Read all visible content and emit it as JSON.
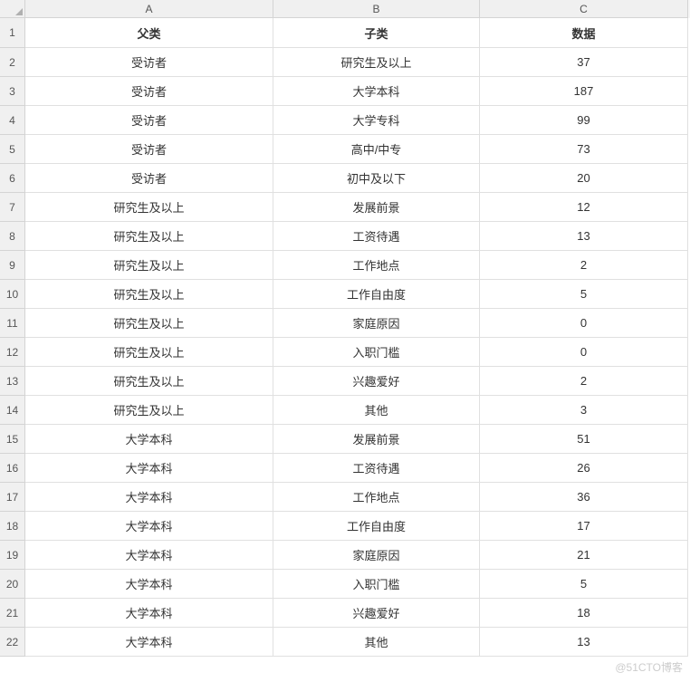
{
  "columns": [
    "A",
    "B",
    "C"
  ],
  "headers": [
    "父类",
    "子类",
    "数据"
  ],
  "rows": [
    {
      "num": 1,
      "parent": "父类",
      "child": "子类",
      "data": "数据"
    },
    {
      "num": 2,
      "parent": "受访者",
      "child": "研究生及以上",
      "data": "37"
    },
    {
      "num": 3,
      "parent": "受访者",
      "child": "大学本科",
      "data": "187"
    },
    {
      "num": 4,
      "parent": "受访者",
      "child": "大学专科",
      "data": "99"
    },
    {
      "num": 5,
      "parent": "受访者",
      "child": "高中/中专",
      "data": "73"
    },
    {
      "num": 6,
      "parent": "受访者",
      "child": "初中及以下",
      "data": "20"
    },
    {
      "num": 7,
      "parent": "研究生及以上",
      "child": "发展前景",
      "data": "12"
    },
    {
      "num": 8,
      "parent": "研究生及以上",
      "child": "工资待遇",
      "data": "13"
    },
    {
      "num": 9,
      "parent": "研究生及以上",
      "child": "工作地点",
      "data": "2"
    },
    {
      "num": 10,
      "parent": "研究生及以上",
      "child": "工作自由度",
      "data": "5"
    },
    {
      "num": 11,
      "parent": "研究生及以上",
      "child": "家庭原因",
      "data": "0"
    },
    {
      "num": 12,
      "parent": "研究生及以上",
      "child": "入职门槛",
      "data": "0"
    },
    {
      "num": 13,
      "parent": "研究生及以上",
      "child": "兴趣爱好",
      "data": "2"
    },
    {
      "num": 14,
      "parent": "研究生及以上",
      "child": "其他",
      "data": "3"
    },
    {
      "num": 15,
      "parent": "大学本科",
      "child": "发展前景",
      "data": "51"
    },
    {
      "num": 16,
      "parent": "大学本科",
      "child": "工资待遇",
      "data": "26"
    },
    {
      "num": 17,
      "parent": "大学本科",
      "child": "工作地点",
      "data": "36"
    },
    {
      "num": 18,
      "parent": "大学本科",
      "child": "工作自由度",
      "data": "17"
    },
    {
      "num": 19,
      "parent": "大学本科",
      "child": "家庭原因",
      "data": "21"
    },
    {
      "num": 20,
      "parent": "大学本科",
      "child": "入职门槛",
      "data": "5"
    },
    {
      "num": 21,
      "parent": "大学本科",
      "child": "兴趣爱好",
      "data": "18"
    },
    {
      "num": 22,
      "parent": "大学本科",
      "child": "其他",
      "data": "13"
    }
  ],
  "watermark": "@51CTO博客"
}
